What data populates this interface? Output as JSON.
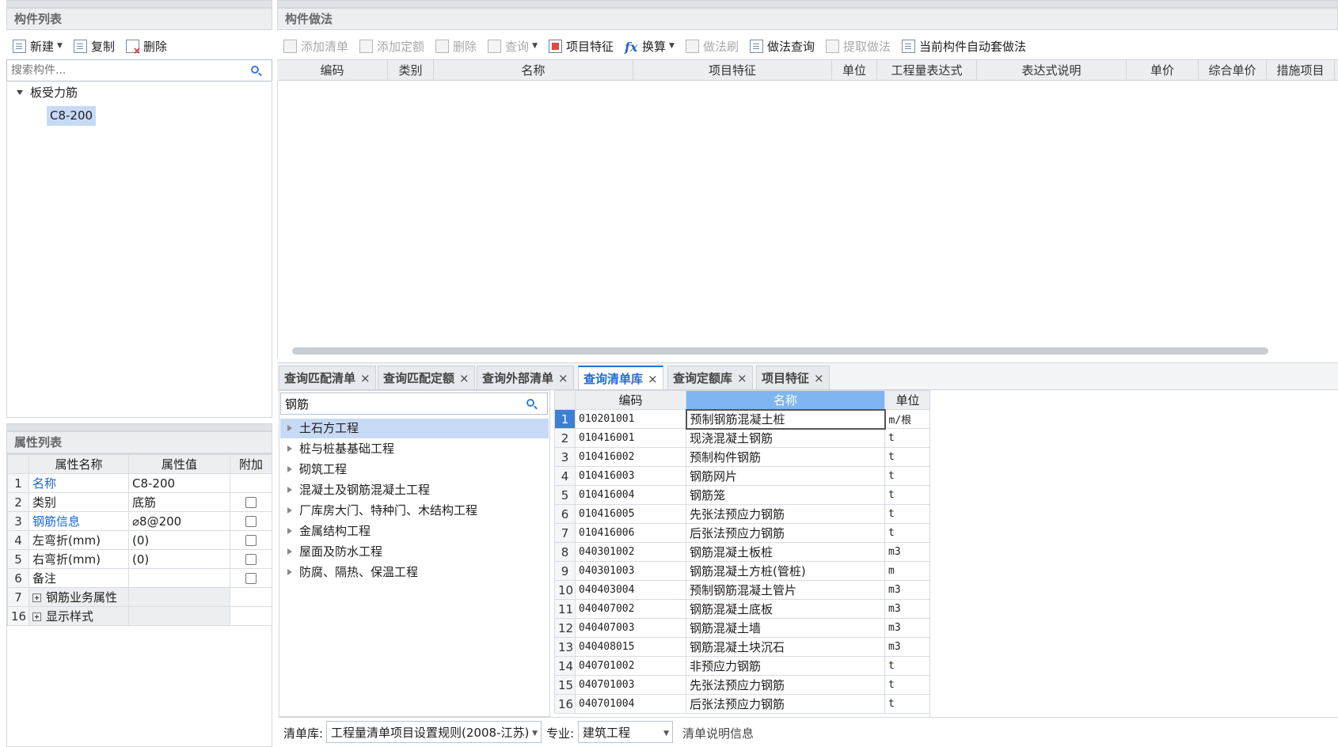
{
  "left": {
    "components": {
      "header": "构件列表",
      "toolbar": {
        "new_label": "新建",
        "copy_label": "复制",
        "delete_label": "删除"
      },
      "search_placeholder": "搜索构件...",
      "tree": {
        "group": "板受力筋",
        "item": "C8-200"
      }
    },
    "properties": {
      "header": "属性列表",
      "columns": [
        "属性名称",
        "属性值",
        "附加"
      ],
      "rows": [
        {
          "num": "1",
          "name": "名称",
          "value": "C8-200"
        },
        {
          "num": "2",
          "name": "类别",
          "value": "底筋"
        },
        {
          "num": "3",
          "name": "钢筋信息",
          "value": "⌀8@200"
        },
        {
          "num": "4",
          "name": "左弯折(mm)",
          "value": "(0)"
        },
        {
          "num": "5",
          "name": "右弯折(mm)",
          "value": "(0)"
        },
        {
          "num": "6",
          "name": "备注",
          "value": ""
        },
        {
          "num": "7",
          "name": "钢筋业务属性",
          "value": ""
        },
        {
          "num": "16",
          "name": "显示样式",
          "value": ""
        }
      ]
    }
  },
  "right": {
    "header": "构件做法",
    "toolbar": {
      "add_list": "添加清单",
      "add_quota": "添加定额",
      "delete": "删除",
      "query": "查询",
      "item_feature": "项目特征",
      "convert": "换算",
      "method_brush": "做法刷",
      "method_query": "做法查询",
      "extract_method": "提取做法",
      "auto_apply": "当前构件自动套做法"
    },
    "columns": [
      "编码",
      "类别",
      "名称",
      "项目特征",
      "单位",
      "工程量表达式",
      "表达式说明",
      "单价",
      "综合单价",
      "措施项目"
    ]
  },
  "tabs": [
    {
      "label": "查询匹配清单",
      "close": "×"
    },
    {
      "label": "查询匹配定额",
      "close": "×"
    },
    {
      "label": "查询外部清单",
      "close": "×"
    },
    {
      "label": "查询清单库",
      "close": "×"
    },
    {
      "label": "查询定额库",
      "close": "×"
    },
    {
      "label": "项目特征",
      "close": "×"
    }
  ],
  "query": {
    "search_value": "钢筋",
    "categories": [
      "土石方工程",
      "桩与桩基基础工程",
      "砌筑工程",
      "混凝土及钢筋混凝土工程",
      "厂库房大门、特种门、木结构工程",
      "金属结构工程",
      "屋面及防水工程",
      "防腐、隔热、保温工程"
    ],
    "result_columns": [
      "编码",
      "名称",
      "单位"
    ],
    "results": [
      {
        "num": "1",
        "code": "010201001",
        "name": "预制钢筋混凝土桩",
        "unit": "m/根"
      },
      {
        "num": "2",
        "code": "010416001",
        "name": "现浇混凝土钢筋",
        "unit": "t"
      },
      {
        "num": "3",
        "code": "010416002",
        "name": "预制构件钢筋",
        "unit": "t"
      },
      {
        "num": "4",
        "code": "010416003",
        "name": "钢筋网片",
        "unit": "t"
      },
      {
        "num": "5",
        "code": "010416004",
        "name": "钢筋笼",
        "unit": "t"
      },
      {
        "num": "6",
        "code": "010416005",
        "name": "先张法预应力钢筋",
        "unit": "t"
      },
      {
        "num": "7",
        "code": "010416006",
        "name": "后张法预应力钢筋",
        "unit": "t"
      },
      {
        "num": "8",
        "code": "040301002",
        "name": "钢筋混凝土板桩",
        "unit": "m3"
      },
      {
        "num": "9",
        "code": "040301003",
        "name": "钢筋混凝土方桩(管桩)",
        "unit": "m"
      },
      {
        "num": "10",
        "code": "040403004",
        "name": "预制钢筋混凝土管片",
        "unit": "m3"
      },
      {
        "num": "11",
        "code": "040407002",
        "name": "钢筋混凝土底板",
        "unit": "m3"
      },
      {
        "num": "12",
        "code": "040407003",
        "name": "钢筋混凝土墙",
        "unit": "m3"
      },
      {
        "num": "13",
        "code": "040408015",
        "name": "钢筋混凝土块沉石",
        "unit": "m3"
      },
      {
        "num": "14",
        "code": "040701002",
        "name": "非预应力钢筋",
        "unit": "t"
      },
      {
        "num": "15",
        "code": "040701003",
        "name": "先张法预应力钢筋",
        "unit": "t"
      },
      {
        "num": "16",
        "code": "040701004",
        "name": "后张法预应力钢筋",
        "unit": "t"
      }
    ],
    "footer": {
      "library_label": "清单库:",
      "library_value": "工程量清单项目设置规则(2008-江苏)",
      "major_label": "专业:",
      "major_value": "建筑工程",
      "info_label": "清单说明信息"
    }
  },
  "colors": {
    "accent": "#1f6ed4",
    "selection": "#c7daf5",
    "header_bg": "#eceef1"
  }
}
